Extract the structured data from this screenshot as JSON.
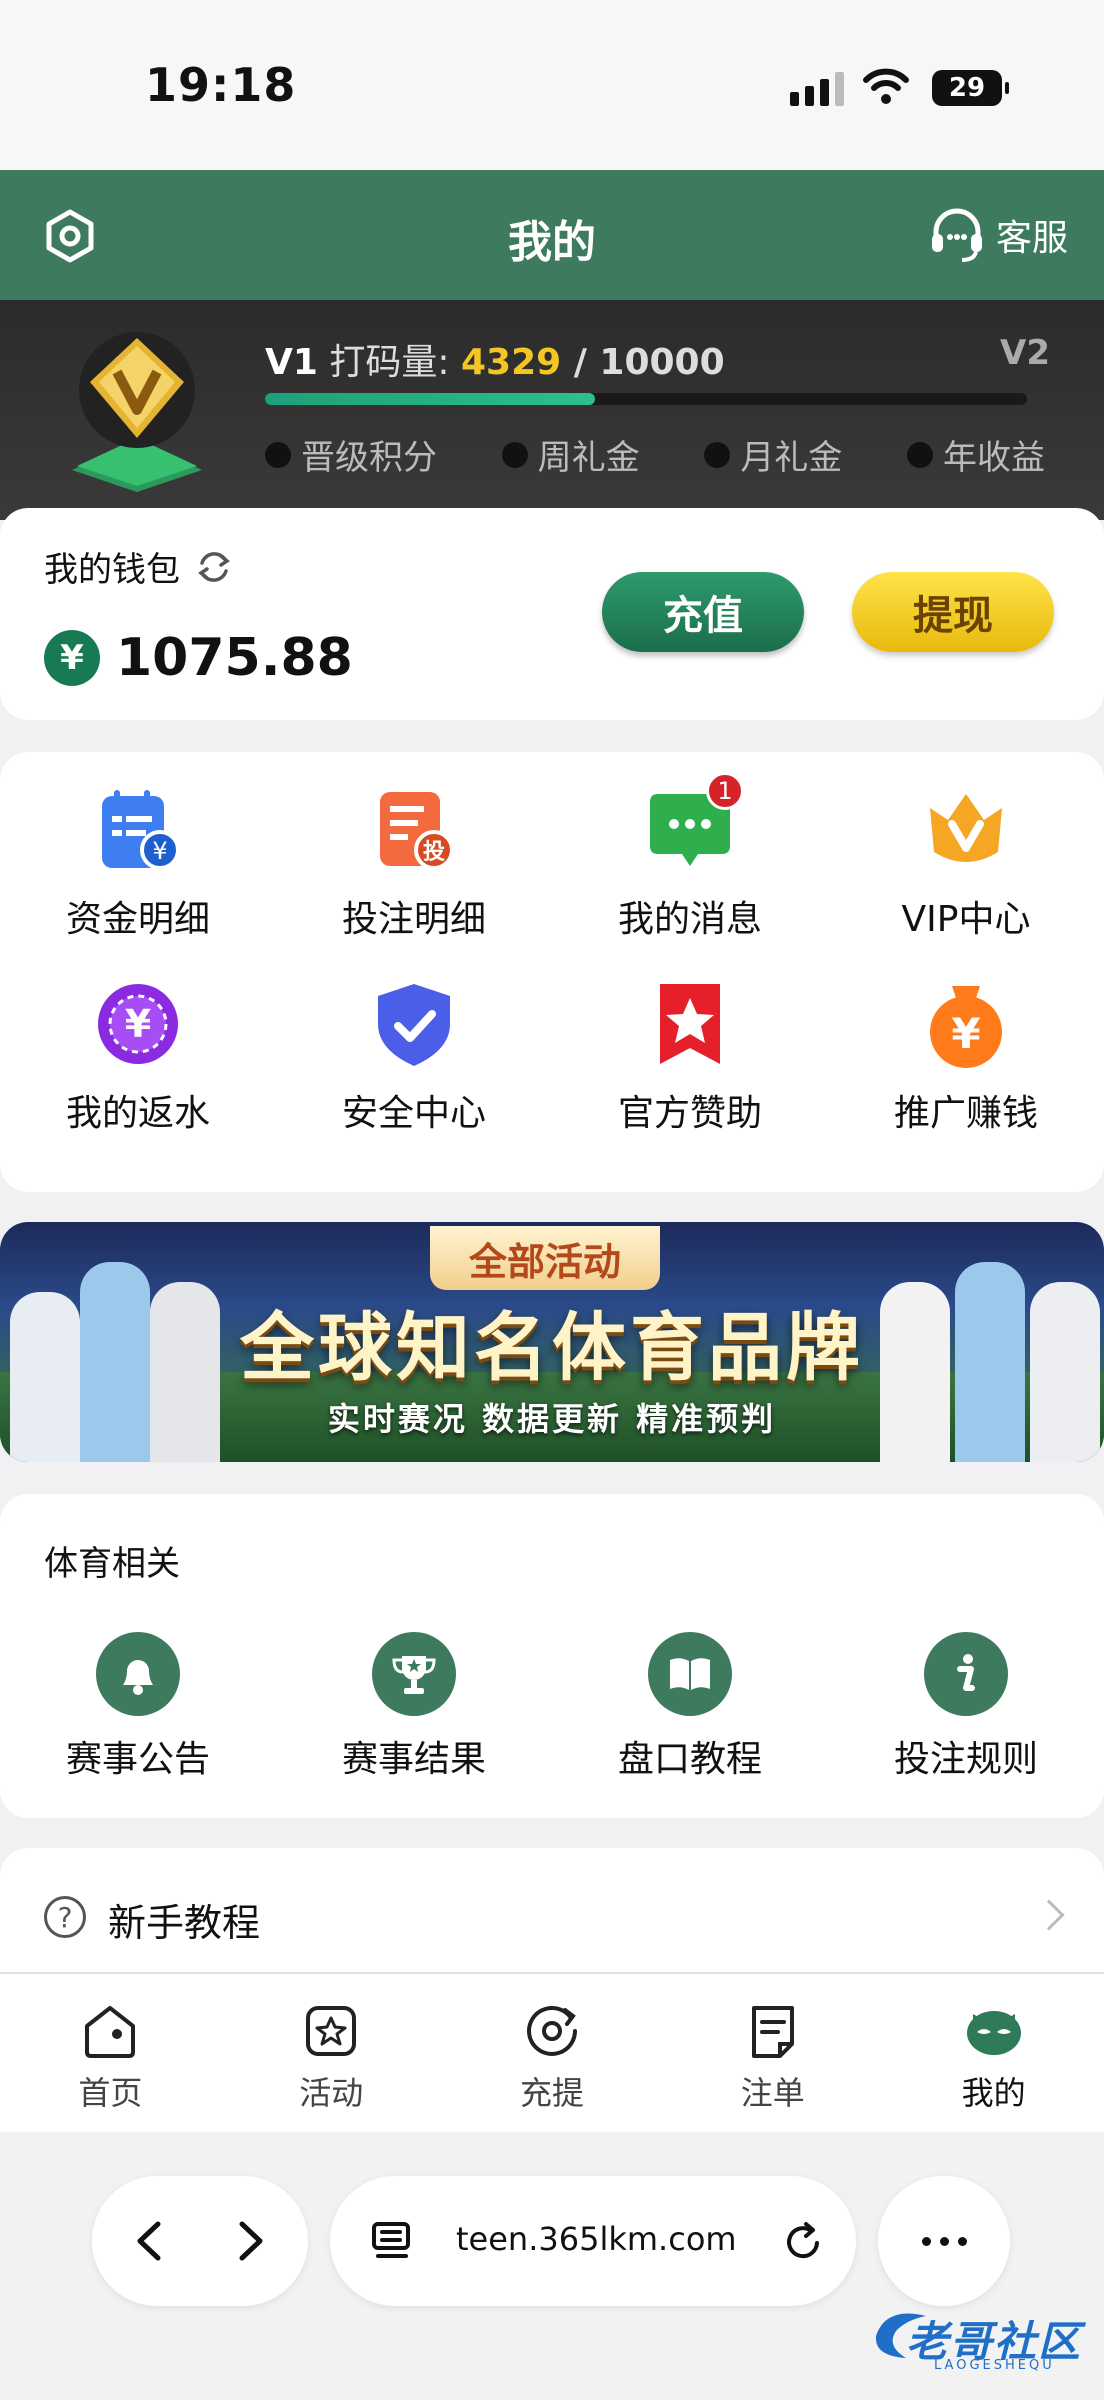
{
  "status_bar": {
    "time": "19:18",
    "battery": "29"
  },
  "header": {
    "title": "我的",
    "customer_service": "客服"
  },
  "vip": {
    "level": "V1",
    "progress_label": "打码量:",
    "current": "4329",
    "separator": " / ",
    "target": "10000",
    "progress_fraction": 0.4329,
    "next_level": "V2",
    "perks": [
      "晋级积分",
      "周礼金",
      "月礼金",
      "年收益"
    ]
  },
  "wallet": {
    "label": "我的钱包",
    "currency_symbol": "¥",
    "balance": "1075.88",
    "deposit_label": "充值",
    "withdraw_label": "提现"
  },
  "grid": {
    "items": [
      {
        "label": "资金明细",
        "icon": "fund-details-icon"
      },
      {
        "label": "投注明细",
        "icon": "bet-details-icon"
      },
      {
        "label": "我的消息",
        "icon": "messages-icon",
        "badge": "1"
      },
      {
        "label": "VIP中心",
        "icon": "vip-crown-icon"
      },
      {
        "label": "我的返水",
        "icon": "rebate-icon"
      },
      {
        "label": "安全中心",
        "icon": "shield-icon"
      },
      {
        "label": "官方赞助",
        "icon": "sponsor-star-icon"
      },
      {
        "label": "推广赚钱",
        "icon": "promote-earn-icon"
      }
    ]
  },
  "banner": {
    "tag": "全部活动",
    "title": "全球知名体育品牌",
    "subtitle": "实时赛况 数据更新 精准预判"
  },
  "sports": {
    "title": "体育相关",
    "items": [
      {
        "label": "赛事公告",
        "icon": "bell-icon"
      },
      {
        "label": "赛事结果",
        "icon": "trophy-icon"
      },
      {
        "label": "盘口教程",
        "icon": "book-icon"
      },
      {
        "label": "投注规则",
        "icon": "info-icon"
      }
    ]
  },
  "tutorial": {
    "label": "新手教程"
  },
  "tabbar": {
    "items": [
      {
        "label": "首页",
        "icon": "home-icon"
      },
      {
        "label": "活动",
        "icon": "activity-icon"
      },
      {
        "label": "充提",
        "icon": "deposit-withdraw-icon"
      },
      {
        "label": "注单",
        "icon": "bet-slip-icon"
      },
      {
        "label": "我的",
        "icon": "profile-icon",
        "active": true
      }
    ]
  },
  "browser": {
    "url": "teen.365lkm.com"
  },
  "watermark": {
    "text": "老哥社区",
    "sub": "LAOGESHEQU"
  },
  "colors": {
    "brand_green": "#3d7a5e",
    "gold": "#f3c623",
    "badge_red": "#d6232a"
  }
}
